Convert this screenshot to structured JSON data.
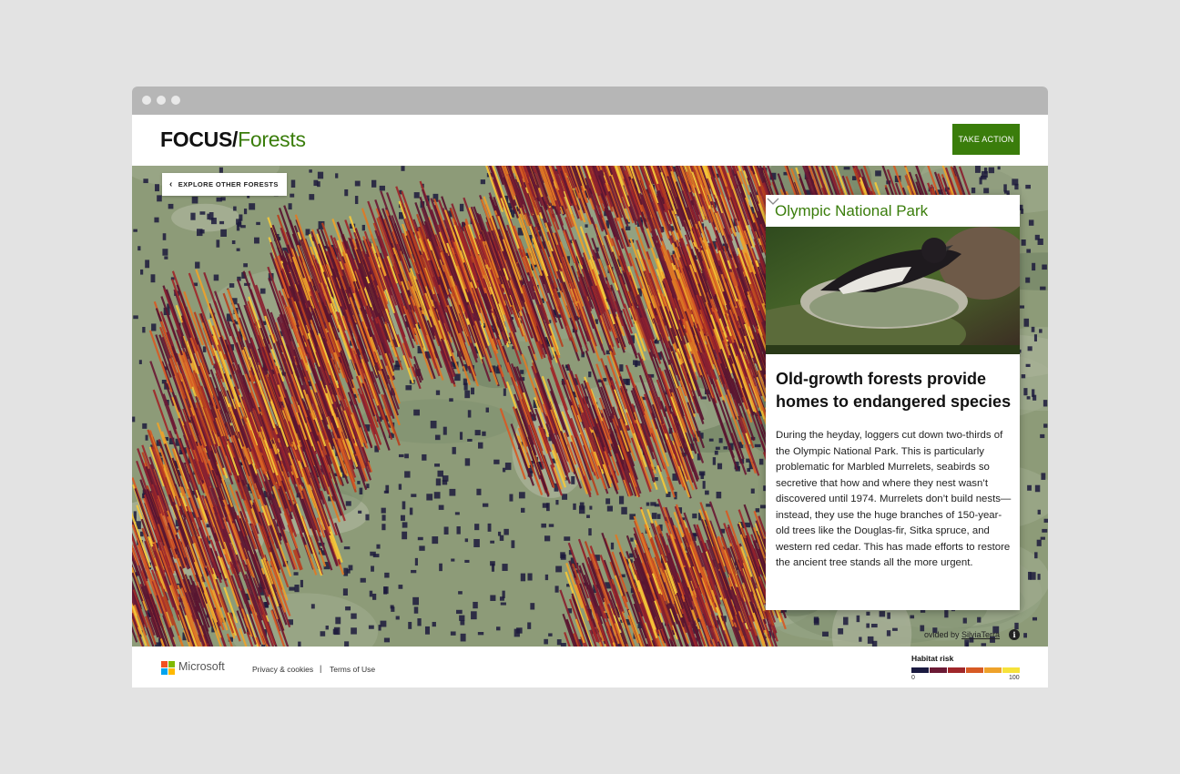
{
  "window": {
    "controls": [
      "close",
      "minimize",
      "maximize"
    ]
  },
  "header": {
    "brand_focus": "FOCUS/",
    "brand_section": "Forests",
    "take_action_label": "TAKE ACTION",
    "accent_color": "#3a7d0b"
  },
  "map": {
    "explore_label": "EXPLORE OTHER FORESTS",
    "explore_icon": "chevron-left-icon",
    "attribution_prefix": "ovided by ",
    "attribution_link": "SilviaTerra",
    "info_icon": "info-icon"
  },
  "card": {
    "title": "Olympic National Park",
    "photo_alt": "Marbled murrelet on nest",
    "heading": "Old-growth forests provide homes to endangered species",
    "body": "During the heyday, loggers cut down two-thirds of the Olympic National Park. This is particularly problematic for Marbled Murrelets, seabirds so secretive that how and where they nest wasn’t discovered until 1974. Murrelets don’t build nests—instead, they use the huge branches of 150-year-old trees like the Douglas-fir, Sitka spruce, and western red cedar. This has made efforts to restore the ancient tree stands all the more urgent.",
    "more_icon": "chevron-down-icon"
  },
  "footer": {
    "company": "Microsoft",
    "links": [
      "Privacy & cookies",
      "Terms of Use"
    ],
    "separator": "|"
  },
  "legend": {
    "title": "Habitat risk",
    "min_label": "0",
    "max_label": "100",
    "colors": [
      "#1a1a40",
      "#6b1a35",
      "#a0272a",
      "#d75a24",
      "#eea22a",
      "#f6e23a"
    ]
  }
}
